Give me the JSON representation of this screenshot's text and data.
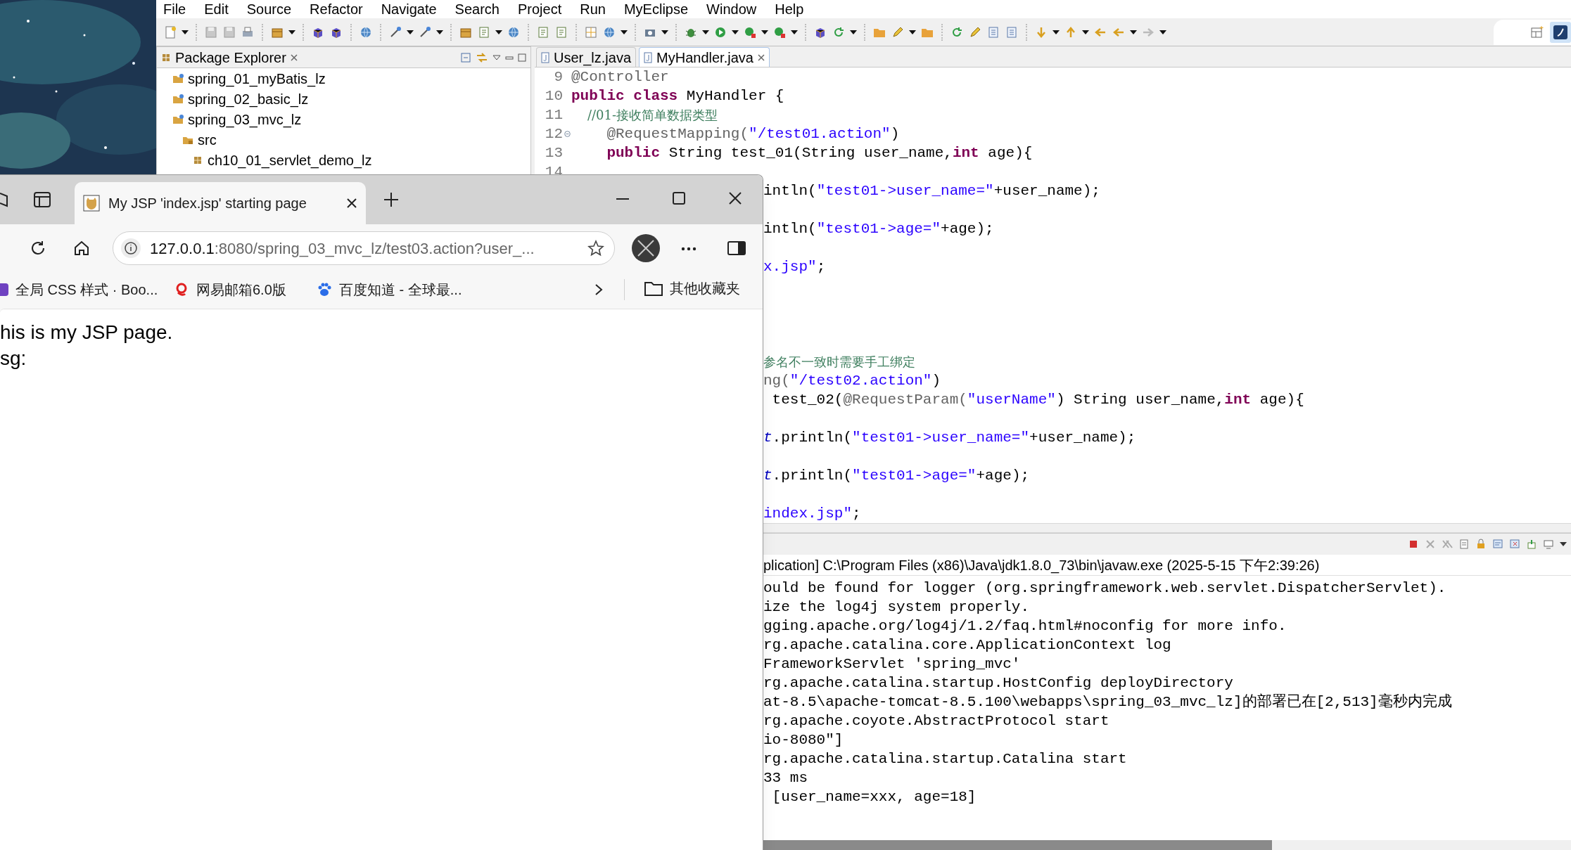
{
  "menu_bar": [
    "File",
    "Edit",
    "Source",
    "Refactor",
    "Navigate",
    "Search",
    "Project",
    "Run",
    "MyEclipse",
    "Window",
    "Help"
  ],
  "package_explorer": {
    "title": "Package Explorer",
    "tree": [
      {
        "label": "spring_01_myBatis_lz",
        "kind": "project"
      },
      {
        "label": "spring_02_basic_lz",
        "kind": "project"
      },
      {
        "label": "spring_03_mvc_lz",
        "kind": "project",
        "children": [
          {
            "label": "src",
            "kind": "folder",
            "children": [
              {
                "label": "ch10_01_servlet_demo_lz",
                "kind": "package"
              }
            ]
          }
        ]
      }
    ]
  },
  "editor": {
    "tabs": [
      {
        "label": "User_lz.java",
        "selected": false
      },
      {
        "label": "MyHandler.java",
        "selected": true
      }
    ],
    "lines": [
      {
        "kind": "numbered",
        "number": "9",
        "tokens": [
          {
            "kind": "annotation",
            "text": "@Controller"
          }
        ]
      },
      {
        "kind": "numbered",
        "number": "10",
        "tokens": [
          {
            "kind": "keyword",
            "text": "public class"
          },
          {
            "kind": "plain",
            "text": " MyHandler {"
          }
        ]
      },
      {
        "kind": "numbered",
        "number": "11",
        "tokens": [
          {
            "kind": "comment",
            "text": "    //01-接收简单数据类型"
          }
        ]
      },
      {
        "kind": "numbered",
        "number": "12",
        "fold": true,
        "tokens": [
          {
            "kind": "annotation",
            "text": "    @RequestMapping("
          },
          {
            "kind": "string",
            "text": "\"/test01.action\""
          },
          {
            "kind": "plain",
            "text": ")"
          }
        ]
      },
      {
        "kind": "numbered",
        "number": "13",
        "tokens": [
          {
            "kind": "keyword",
            "text": "    public"
          },
          {
            "kind": "plain",
            "text": " String test_01(String user_name,"
          },
          {
            "kind": "keyword",
            "text": "int"
          },
          {
            "kind": "plain",
            "text": " age){"
          }
        ]
      },
      {
        "kind": "numbered",
        "number": "14"
      },
      {
        "kind": "clipped",
        "tokens": [
          {
            "kind": "plain",
            "text": "intln("
          },
          {
            "kind": "string",
            "text": "\"test01->user_name=\""
          },
          {
            "kind": "plain",
            "text": "+user_name);"
          }
        ]
      },
      {
        "kind": "blank"
      },
      {
        "kind": "clipped",
        "tokens": [
          {
            "kind": "plain",
            "text": "intln("
          },
          {
            "kind": "string",
            "text": "\"test01->age=\""
          },
          {
            "kind": "plain",
            "text": "+age);"
          }
        ]
      },
      {
        "kind": "blank"
      },
      {
        "kind": "clipped",
        "tokens": [
          {
            "kind": "string",
            "text": "x.jsp\""
          },
          {
            "kind": "plain",
            "text": ";"
          }
        ]
      },
      {
        "kind": "blank"
      },
      {
        "kind": "blank"
      },
      {
        "kind": "blank"
      },
      {
        "kind": "blank"
      },
      {
        "kind": "clipped",
        "tokens": [
          {
            "kind": "comment",
            "text": "参名不一致时需要手工绑定"
          }
        ]
      },
      {
        "kind": "clipped",
        "tokens": [
          {
            "kind": "annotation",
            "text": "ng("
          },
          {
            "kind": "string",
            "text": "\"/test02.action\""
          },
          {
            "kind": "plain",
            "text": ")"
          }
        ]
      },
      {
        "kind": "clipped",
        "tokens": [
          {
            "kind": "plain",
            "text": " test_02("
          },
          {
            "kind": "annotation",
            "text": "@RequestParam("
          },
          {
            "kind": "string",
            "text": "\"userName\""
          },
          {
            "kind": "plain",
            "text": ") String user_name,"
          },
          {
            "kind": "keyword",
            "text": "int"
          },
          {
            "kind": "plain",
            "text": " age){"
          }
        ]
      },
      {
        "kind": "blank"
      },
      {
        "kind": "clipped",
        "tokens": [
          {
            "kind": "field",
            "text": "t"
          },
          {
            "kind": "plain",
            "text": ".println("
          },
          {
            "kind": "string",
            "text": "\"test01->user_name=\""
          },
          {
            "kind": "plain",
            "text": "+user_name);"
          }
        ]
      },
      {
        "kind": "blank"
      },
      {
        "kind": "clipped",
        "tokens": [
          {
            "kind": "field",
            "text": "t"
          },
          {
            "kind": "plain",
            "text": ".println("
          },
          {
            "kind": "string",
            "text": "\"test01->age=\""
          },
          {
            "kind": "plain",
            "text": "+age);"
          }
        ]
      },
      {
        "kind": "blank"
      },
      {
        "kind": "clipped",
        "tokens": [
          {
            "kind": "string",
            "text": "index.jsp\""
          },
          {
            "kind": "plain",
            "text": ";"
          }
        ]
      }
    ]
  },
  "console": {
    "header": "plication] C:\\Program Files (x86)\\Java\\jdk1.8.0_73\\bin\\javaw.exe (2025-5-15 下午2:39:26)",
    "lines": [
      "ould be found for logger (org.springframework.web.servlet.DispatcherServlet).",
      "ize the log4j system properly.",
      "gging.apache.org/log4j/1.2/faq.html#noconfig for more info.",
      "rg.apache.catalina.core.ApplicationContext log",
      "FrameworkServlet 'spring_mvc'",
      "rg.apache.catalina.startup.HostConfig deployDirectory",
      "at-8.5\\apache-tomcat-8.5.100\\webapps\\spring_03_mvc_lz]的部署已在[2,513]毫秒内完成",
      "rg.apache.coyote.AbstractProtocol start",
      "io-8080\"]",
      "rg.apache.catalina.startup.Catalina start",
      "33 ms",
      " [user_name=xxx, age=18]"
    ]
  },
  "browser": {
    "tab_title": "My JSP 'index.jsp' starting page",
    "address": {
      "host": "127.0.0.1",
      "rest": ":8080/spring_03_mvc_lz/test03.action?user_..."
    },
    "bookmarks": [
      {
        "label": "全局 CSS 样式 · Boo...",
        "kind": "square"
      },
      {
        "label": "网易邮箱6.0版",
        "kind": "swirl"
      },
      {
        "label": "百度知道 - 全球最...",
        "kind": "paw"
      }
    ],
    "other_bookmarks": "其他收藏夹",
    "content": [
      "his is my JSP page.",
      "sg:"
    ]
  }
}
